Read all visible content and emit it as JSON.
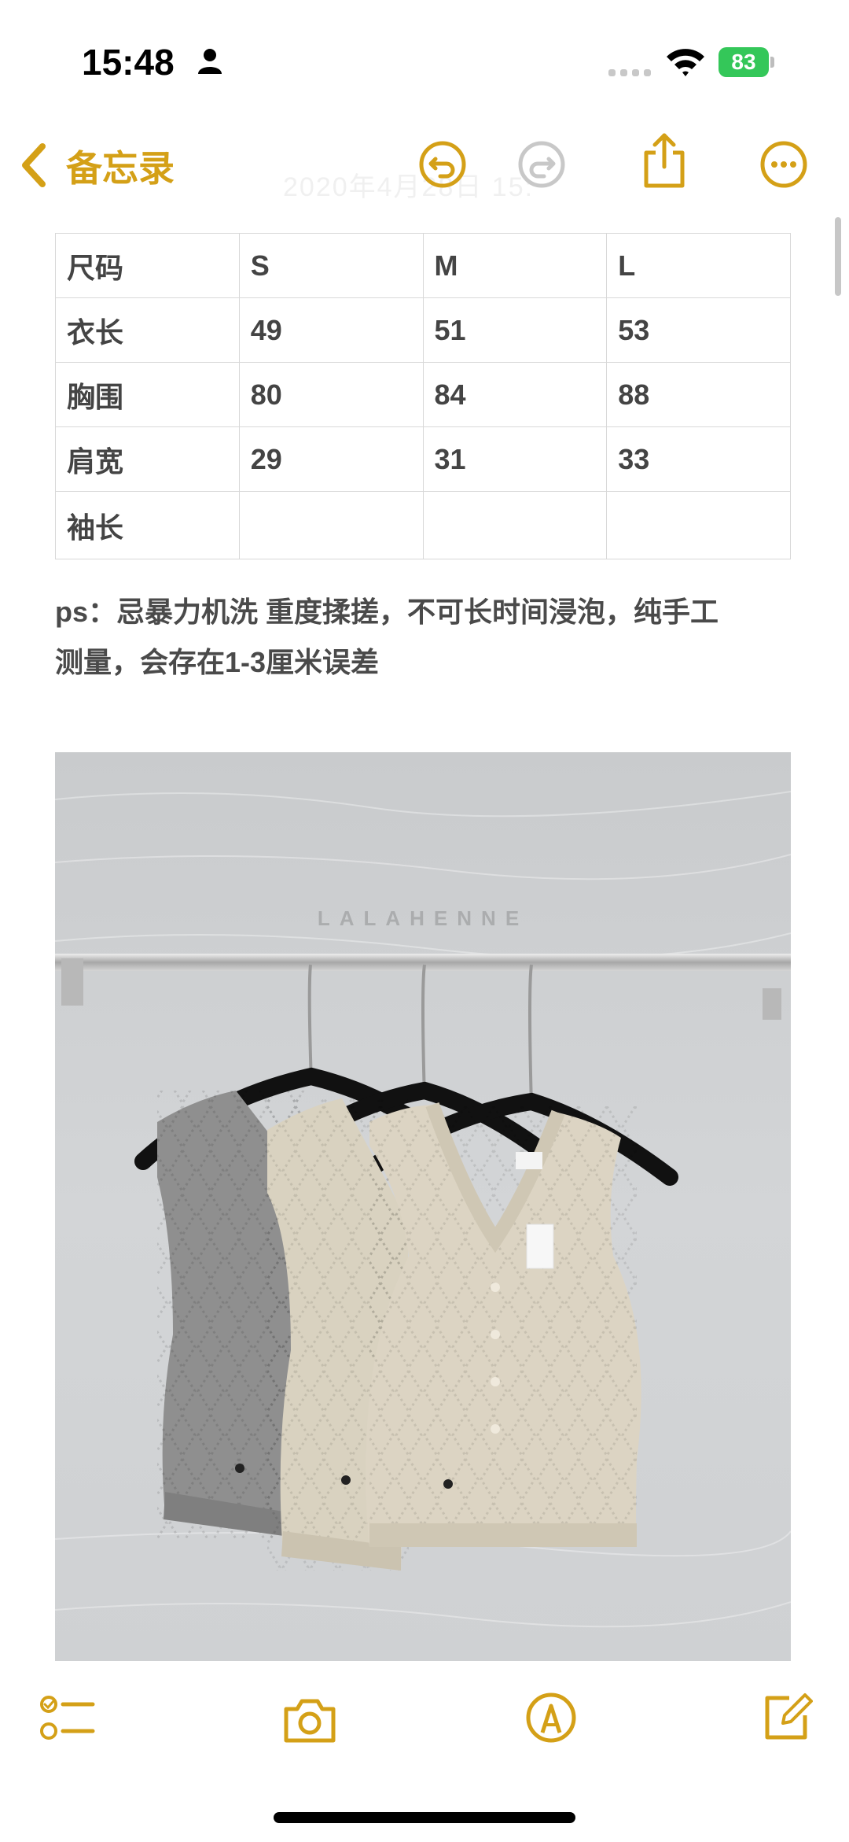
{
  "status_bar": {
    "time": "15:48",
    "battery": "83",
    "icons": [
      "person-icon",
      "signal-icon",
      "wifi-icon",
      "battery-icon"
    ]
  },
  "nav": {
    "back_label": "备忘录",
    "faint_title": "2020年4月28日 15:",
    "icons": [
      "chevron-left-icon",
      "undo-icon",
      "redo-icon",
      "share-icon",
      "more-icon"
    ],
    "accent_color": "#d4a017"
  },
  "table": {
    "header": [
      "尺码",
      "S",
      "M",
      "L"
    ],
    "rows": [
      [
        "衣长",
        "49",
        "51",
        "53"
      ],
      [
        "胸围",
        "80",
        "84",
        "88"
      ],
      [
        "肩宽",
        "29",
        "31",
        "33"
      ],
      [
        "袖长",
        "",
        "",
        ""
      ]
    ]
  },
  "note": {
    "line1": "ps：忌暴力机洗 重度揉搓，不可长时间浸泡，纯手工",
    "line2": "测量，会存在1-3厘米误差"
  },
  "photo": {
    "watermark": "LALAHENNE",
    "vest_colors": [
      "#8f8f8f",
      "#d9d2c0",
      "#dcd4c3"
    ]
  },
  "toolbar": {
    "icons": [
      "checklist-icon",
      "camera-icon",
      "markup-icon",
      "compose-icon"
    ]
  }
}
